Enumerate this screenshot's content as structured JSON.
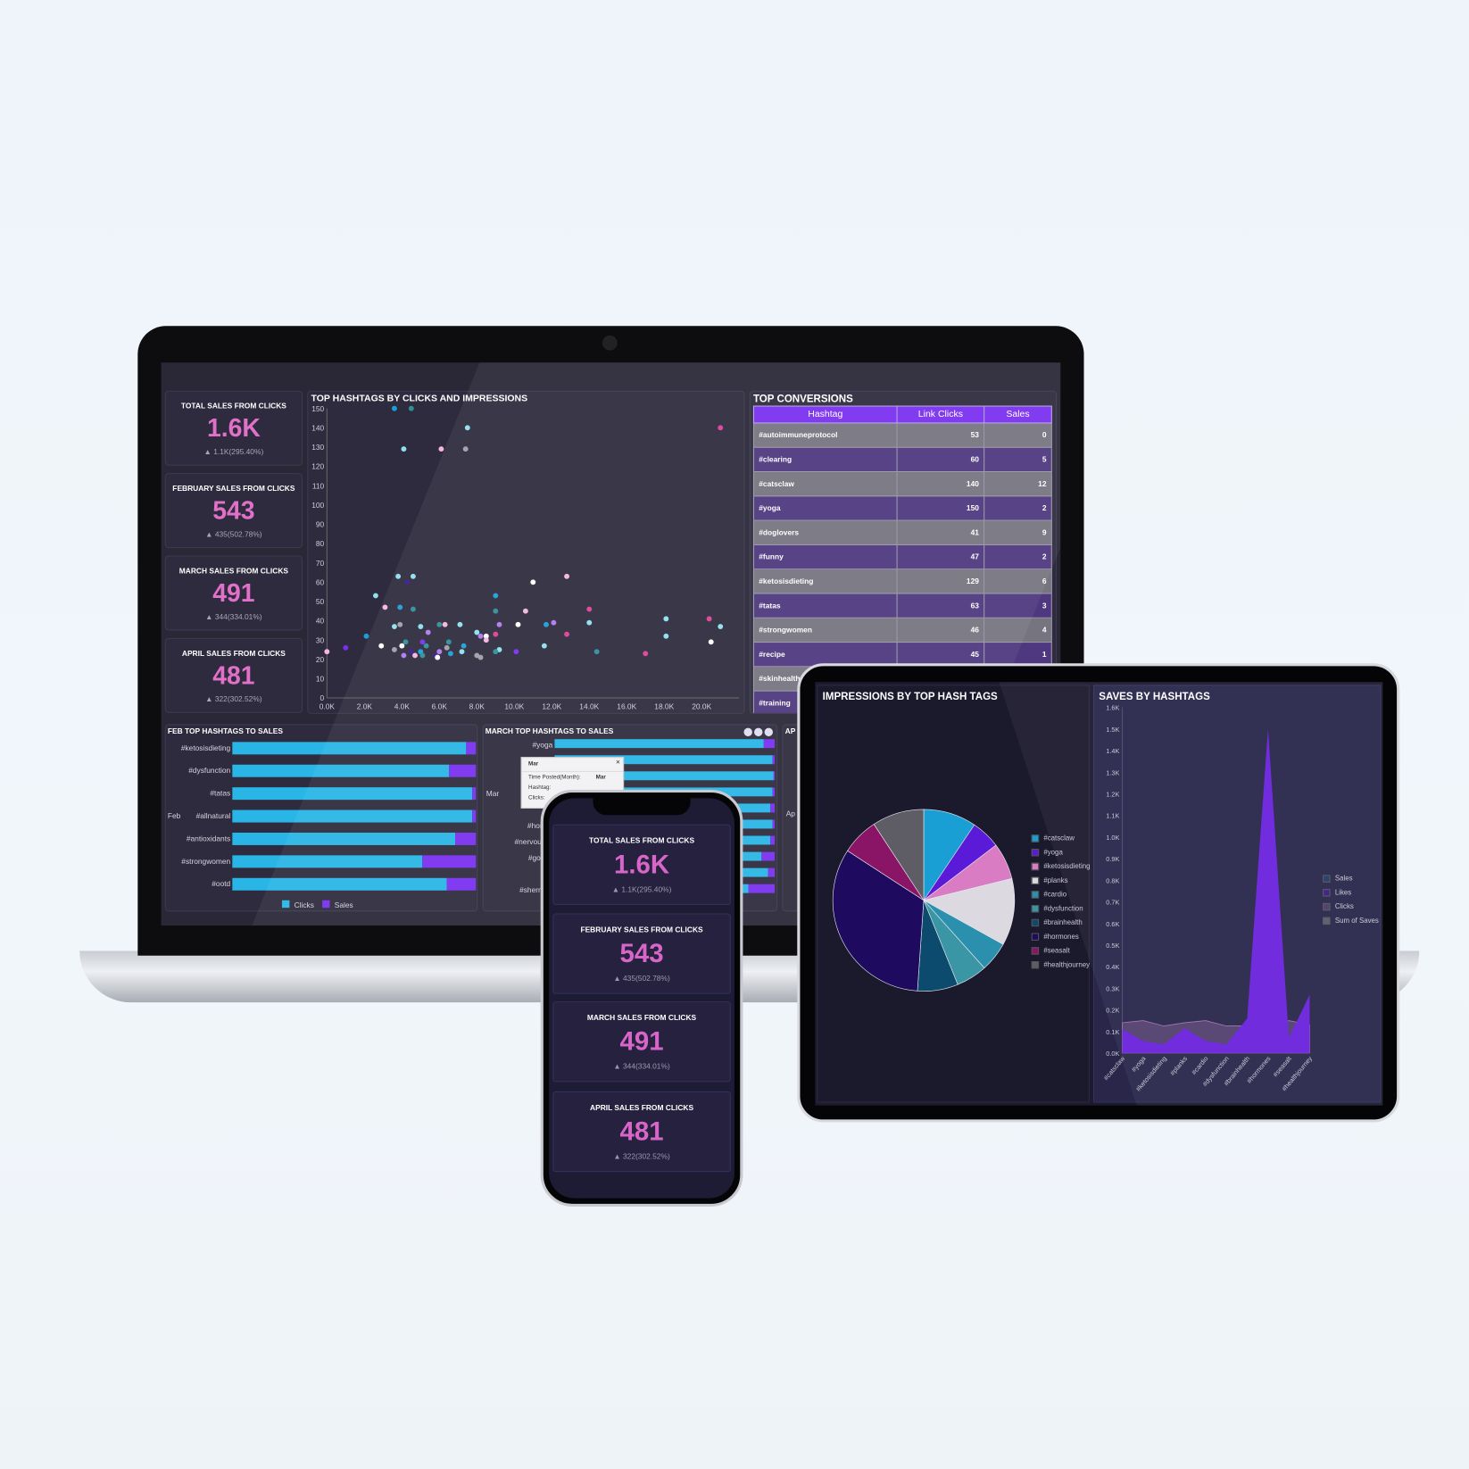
{
  "laptop": {
    "kpis": [
      {
        "title": "TOTAL SALES FROM CLICKS",
        "value": "1.6K",
        "delta": "1.1K(295.40%)"
      },
      {
        "title": "FEBRUARY SALES FROM CLICKS",
        "value": "543",
        "delta": "435(502.78%)"
      },
      {
        "title": "MARCH SALES FROM CLICKS",
        "value": "491",
        "delta": "344(334.01%)"
      },
      {
        "title": "APRIL SALES FROM CLICKS",
        "value": "481",
        "delta": "322(302.52%)"
      }
    ],
    "delta_icon": "triangle-up-icon",
    "table": {
      "title": "TOP CONVERSIONS",
      "columns": [
        "Hashtag",
        "Link Clicks",
        "Sales"
      ],
      "rows": [
        [
          "#autoimmuneprotocol",
          "53",
          "0"
        ],
        [
          "#clearing",
          "60",
          "5"
        ],
        [
          "#catsclaw",
          "140",
          "12"
        ],
        [
          "#yoga",
          "150",
          "2"
        ],
        [
          "#doglovers",
          "41",
          "9"
        ],
        [
          "#funny",
          "47",
          "2"
        ],
        [
          "#ketosisdieting",
          "129",
          "6"
        ],
        [
          "#tatas",
          "63",
          "3"
        ],
        [
          "#strongwomen",
          "46",
          "4"
        ],
        [
          "#recipe",
          "45",
          "1"
        ],
        [
          "#skinhealth",
          "",
          ""
        ],
        [
          "#training",
          "",
          ""
        ]
      ]
    },
    "tooltip": {
      "title": "Mar",
      "rows": [
        [
          "Time Posted(Month):",
          "Mar"
        ],
        [
          "Hashtag:",
          ""
        ],
        [
          "Clicks:",
          ""
        ]
      ]
    },
    "april_panel": {
      "title": "AP",
      "row_label": "Ap"
    },
    "toolbar_icons": [
      "expand-icon",
      "export-icon",
      "settings-icon"
    ]
  },
  "phone": {
    "kpis": [
      {
        "title": "TOTAL SALES FROM CLICKS",
        "value": "1.6K",
        "delta": "1.1K(295.40%)"
      },
      {
        "title": "FEBRUARY SALES FROM CLICKS",
        "value": "543",
        "delta": "435(502.78%)"
      },
      {
        "title": "MARCH SALES FROM CLICKS",
        "value": "491",
        "delta": "344(334.01%)"
      },
      {
        "title": "APRIL SALES FROM CLICKS",
        "value": "481",
        "delta": "322(302.52%)"
      }
    ]
  },
  "colors": {
    "accent_pink": "#e070c8",
    "clicks": "#29b6e6",
    "sales": "#7a2ff0",
    "header_purple": "#7a2ff0"
  },
  "chart_data": [
    {
      "type": "scatter",
      "title": "TOP HASHTAGS BY CLICKS AND IMPRESSIONS",
      "xlim": [
        0,
        21
      ],
      "ylim": [
        0,
        150
      ],
      "xticks": [
        "0.0K",
        "2.0K",
        "4.0K",
        "6.0K",
        "8.0K",
        "10.0K",
        "12.0K",
        "14.0K",
        "16.0K",
        "18.0K",
        "20.0K"
      ],
      "yticks": [
        "0",
        "10",
        "20",
        "30",
        "40",
        "50",
        "60",
        "70",
        "80",
        "90",
        "100",
        "110",
        "120",
        "130",
        "140",
        "150"
      ],
      "palette": [
        "#1aa0d8",
        "#2f8f9a",
        "#ffffff",
        "#f4b6e0",
        "#8fe0ee",
        "#7a2ff0",
        "#b07af0",
        "#e0409a",
        "#a0a0a8",
        "#3a1a90"
      ],
      "points": [
        [
          3.6,
          150,
          0
        ],
        [
          4.5,
          150,
          1
        ],
        [
          7.5,
          140,
          4
        ],
        [
          4.1,
          129,
          4
        ],
        [
          6.1,
          129,
          3
        ],
        [
          7.4,
          129,
          8
        ],
        [
          21.0,
          140,
          7
        ],
        [
          3.8,
          63,
          4
        ],
        [
          4.6,
          63,
          4
        ],
        [
          4.3,
          60,
          9
        ],
        [
          2.6,
          53,
          4
        ],
        [
          3.1,
          47,
          3
        ],
        [
          3.9,
          47,
          0
        ],
        [
          4.6,
          46,
          1
        ],
        [
          11.0,
          60,
          2
        ],
        [
          12.8,
          63,
          3
        ],
        [
          9.0,
          53,
          0
        ],
        [
          9.0,
          45,
          1
        ],
        [
          10.6,
          45,
          3
        ],
        [
          14.0,
          46,
          7
        ],
        [
          3.6,
          37,
          4
        ],
        [
          3.9,
          38,
          8
        ],
        [
          5.0,
          37,
          4
        ],
        [
          5.4,
          34,
          6
        ],
        [
          6.3,
          38,
          3
        ],
        [
          7.1,
          38,
          4
        ],
        [
          6.0,
          38,
          1
        ],
        [
          8.0,
          34,
          4
        ],
        [
          9.2,
          38,
          6
        ],
        [
          10.2,
          38,
          2
        ],
        [
          11.7,
          38,
          0
        ],
        [
          12.1,
          39,
          6
        ],
        [
          14.0,
          39,
          4
        ],
        [
          18.1,
          41,
          4
        ],
        [
          20.4,
          41,
          7
        ],
        [
          21.0,
          37,
          4
        ],
        [
          12.8,
          33,
          7
        ],
        [
          18.1,
          32,
          4
        ],
        [
          20.5,
          29,
          2
        ],
        [
          2.1,
          32,
          0
        ],
        [
          1.0,
          26,
          5
        ],
        [
          2.9,
          27,
          2
        ],
        [
          3.6,
          25,
          8
        ],
        [
          4.0,
          27,
          2
        ],
        [
          4.2,
          29,
          1
        ],
        [
          5.1,
          29,
          5
        ],
        [
          5.3,
          27,
          1
        ],
        [
          6.4,
          26,
          8
        ],
        [
          6.5,
          29,
          1
        ],
        [
          7.3,
          27,
          0
        ],
        [
          8.2,
          32,
          6
        ],
        [
          8.5,
          32,
          2
        ],
        [
          9.0,
          33,
          7
        ],
        [
          8.5,
          30,
          3
        ],
        [
          11.6,
          27,
          4
        ],
        [
          14.4,
          24,
          1
        ],
        [
          17.0,
          23,
          7
        ],
        [
          0,
          24,
          3
        ],
        [
          4.1,
          22,
          6
        ],
        [
          4.5,
          24,
          9
        ],
        [
          4.7,
          22,
          3
        ],
        [
          5.0,
          24,
          0
        ],
        [
          5.1,
          22,
          1
        ],
        [
          5.8,
          22,
          9
        ],
        [
          5.9,
          21,
          2
        ],
        [
          6.0,
          24,
          6
        ],
        [
          6.6,
          23,
          0
        ],
        [
          7.2,
          24,
          4
        ],
        [
          8.0,
          22,
          8
        ],
        [
          8.2,
          21,
          8
        ],
        [
          9.2,
          25,
          4
        ],
        [
          9.0,
          24,
          1
        ],
        [
          10.1,
          24,
          5
        ]
      ]
    },
    {
      "type": "bar",
      "title": "FEB TOP HASHTAGS TO SALES",
      "group": "Feb",
      "categories": [
        "#ketosisdieting",
        "#dysfunction",
        "#tatas",
        "#allnatural",
        "#antioxidants",
        "#strongwomen",
        "#ootd"
      ],
      "series": [
        {
          "name": "Clicks",
          "values": [
            96,
            89,
            98.5,
            98.5,
            91.5,
            78,
            88
          ]
        },
        {
          "name": "Sales",
          "values": [
            4,
            11,
            1.5,
            1.5,
            8.5,
            22,
            12
          ]
        }
      ],
      "stacked": true,
      "legend": [
        "Clicks",
        "Sales"
      ]
    },
    {
      "type": "bar",
      "title": "MARCH TOP HASHTAGS TO SALES",
      "group": "Mar",
      "categories": [
        "#yoga",
        "",
        "",
        "",
        "#p",
        "#hormo",
        "#nervoussy",
        "#goodv",
        "#f",
        "#sherman"
      ],
      "series": [
        {
          "name": "Clicks",
          "values": [
            95,
            99,
            99.5,
            99,
            98,
            99,
            98,
            94,
            97,
            88
          ]
        },
        {
          "name": "Sales",
          "values": [
            5,
            1,
            0.5,
            1,
            2,
            1,
            2,
            6,
            3,
            12
          ]
        }
      ],
      "stacked": true
    },
    {
      "type": "pie",
      "title": "IMPRESSIONS BY TOP HASH TAGS",
      "labels": [
        "#catsclaw",
        "#yoga",
        "#ketosisdieting",
        "#planks",
        "#cardio",
        "#dysfunction",
        "#brainhealth",
        "#hormones",
        "#seasalt",
        "#healthjourney"
      ],
      "values": [
        9.4,
        5.2,
        6.5,
        11.9,
        5.3,
        5.5,
        7.2,
        33.0,
        6.6,
        9.2
      ],
      "colors": [
        "#1a9fd4",
        "#5a1ad8",
        "#d97cc4",
        "#dcdae0",
        "#2a90ae",
        "#3a96a4",
        "#0c4a6e",
        "#1e0a5e",
        "#8a1466",
        "#5e5d66"
      ],
      "legend": "right"
    },
    {
      "type": "area",
      "title": "SAVES BY HASHTAGS",
      "categories": [
        "#catsclaw",
        "#yoga",
        "#ketosisdieting",
        "#planks",
        "#cardio",
        "#dysfunction",
        "#brainhealth",
        "#hormones",
        "#seasalt",
        "#healthjourney"
      ],
      "ylim": [
        0,
        1.6
      ],
      "yticks": [
        "0.0K",
        "0.1K",
        "0.2K",
        "0.3K",
        "0.4K",
        "0.5K",
        "0.6K",
        "0.7K",
        "0.8K",
        "0.9K",
        "1.0K",
        "1.1K",
        "1.2K",
        "1.3K",
        "1.4K",
        "1.5K",
        "1.6K"
      ],
      "series": [
        {
          "name": "Clicks",
          "values": [
            0.14,
            0.15,
            0.125,
            0.14,
            0.15,
            0.125,
            0.125,
            0.125,
            0.15,
            0.13
          ],
          "color": "#52406e"
        },
        {
          "name": "Likes",
          "values": [
            0.11,
            0.055,
            0.04,
            0.115,
            0.055,
            0.04,
            0.16,
            1.5,
            0.07,
            0.27
          ],
          "color": "#6a22dc"
        }
      ],
      "legend": [
        {
          "name": "Sales",
          "color": "#1e3a6a"
        },
        {
          "name": "Likes",
          "color": "#3a1a8a"
        },
        {
          "name": "Clicks",
          "color": "#4a3a6a"
        },
        {
          "name": "Sum of Saves",
          "color": "#5a5a6e"
        }
      ]
    }
  ]
}
